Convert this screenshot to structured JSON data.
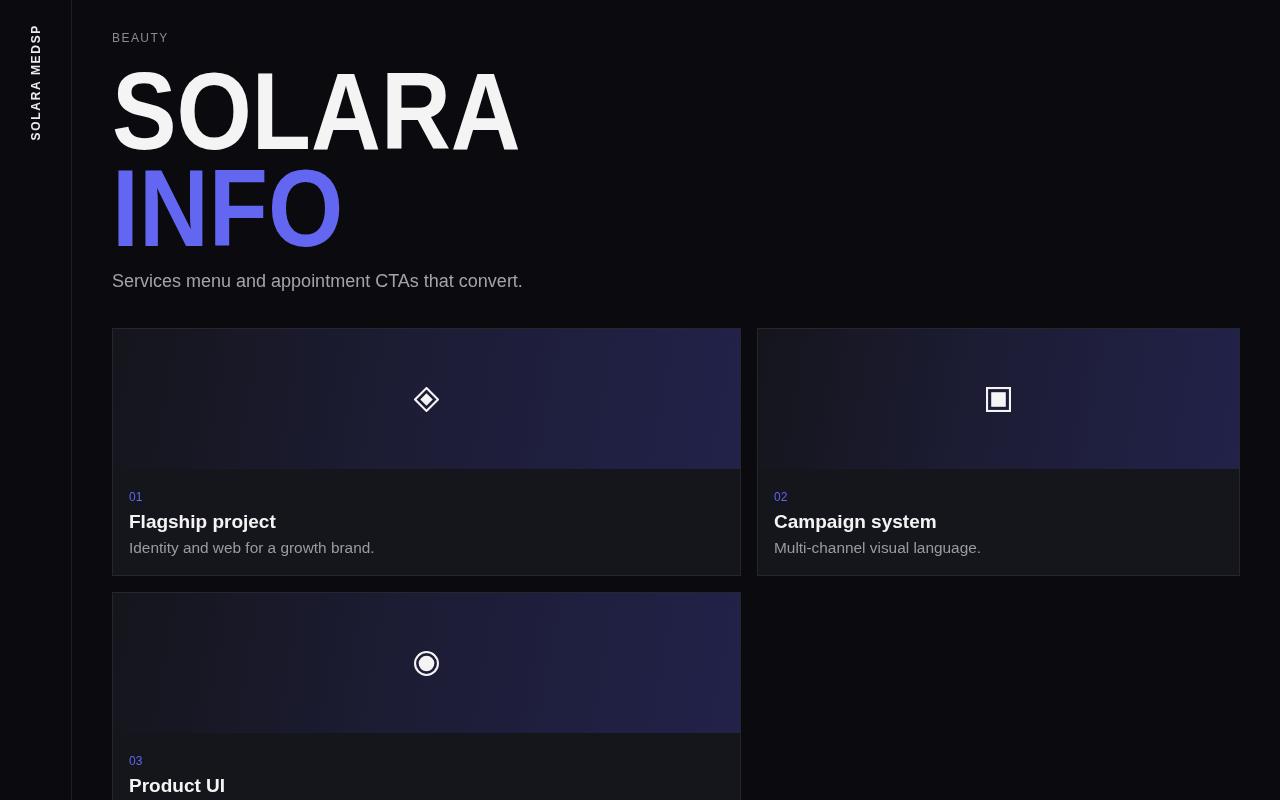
{
  "sidebar": {
    "brand": "SOLARA MEDSP"
  },
  "hero": {
    "eyebrow": "BEAUTY",
    "title_lines": [
      {
        "text": "SOLARA",
        "accent": false
      },
      {
        "text": "INFO",
        "accent": true
      }
    ],
    "subtitle": "Services menu and appointment CTAs that convert."
  },
  "projects": [
    {
      "number": "01",
      "title": "Flagship project",
      "description": "Identity and web for a growth brand.",
      "kind": "diamond"
    },
    {
      "number": "02",
      "title": "Campaign system",
      "description": "Multi-channel visual language.",
      "kind": "square"
    },
    {
      "number": "03",
      "title": "Product UI",
      "kind": "circle"
    }
  ]
}
